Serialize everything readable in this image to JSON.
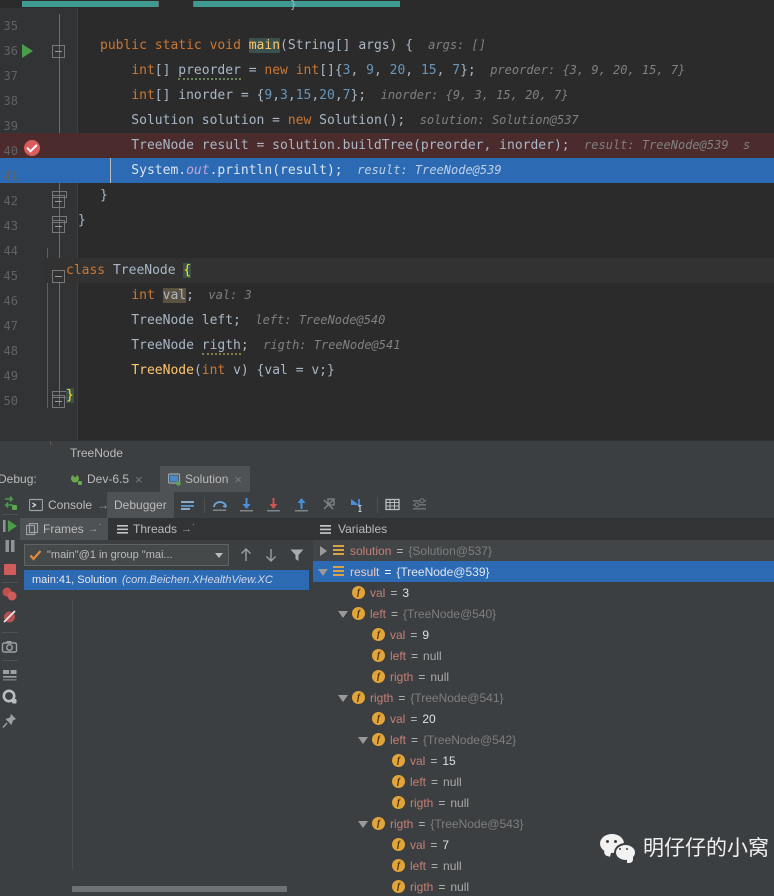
{
  "editor": {
    "top_bar_brace": "}",
    "lines": [
      {
        "no": "35",
        "text": ""
      },
      {
        "no": "36",
        "text": "public static void main(String[] args) {",
        "hint": "args: []"
      },
      {
        "no": "37",
        "text": "int[] preorder = new int[]{3, 9, 20, 15, 7};",
        "hint": "preorder: {3, 9, 20, 15, 7}"
      },
      {
        "no": "38",
        "text": "int[] inorder = {9,3,15,20,7};",
        "hint": "inorder: {9, 3, 15, 20, 7}"
      },
      {
        "no": "39",
        "text": "Solution solution = new Solution();",
        "hint": "solution: Solution@537"
      },
      {
        "no": "40",
        "text": "TreeNode result = solution.buildTree(preorder, inorder);",
        "hint": "result: TreeNode@539  s"
      },
      {
        "no": "41",
        "text": "System.out.println(result);",
        "hint": "result: TreeNode@539"
      },
      {
        "no": "42",
        "text": "}"
      },
      {
        "no": "43",
        "text": "}"
      },
      {
        "no": "44",
        "text": ""
      },
      {
        "no": "45",
        "text": "class TreeNode {"
      },
      {
        "no": "46",
        "text": "int val;",
        "hint": "val: 3"
      },
      {
        "no": "47",
        "text": "TreeNode left;",
        "hint": "left: TreeNode@540"
      },
      {
        "no": "48",
        "text": "TreeNode rigth;",
        "hint": "rigth: TreeNode@541"
      },
      {
        "no": "49",
        "text": "TreeNode(int v) {val = v;}"
      },
      {
        "no": "50",
        "text": "}"
      }
    ],
    "tokens": {
      "kw_public": "public",
      "kw_static": "static",
      "kw_void": "void",
      "fn_main": "main",
      "t_string_args": "(String[] args) {",
      "kw_int": "int",
      "id_preorder": "preorder",
      "kw_new": "new",
      "kw_class": "class",
      "id_treenode": "TreeNode",
      "id_val": "val",
      "id_left": "left",
      "id_rigth": "rigth",
      "id_v": "v",
      "id_solution": "Solution",
      "id_result": "result",
      "id_system": "System",
      "id_out": "out",
      "id_println": "println",
      "id_inorder": "inorder",
      "id_buildtree": "buildTree"
    }
  },
  "breadcrumb": {
    "path": "TreeNode"
  },
  "debug_tabs": {
    "label": "Debug:",
    "tabs": [
      {
        "name": "Dev-6.5",
        "icon": "android-run-icon",
        "close": "×",
        "active": false
      },
      {
        "name": "Solution",
        "icon": "java-app-icon",
        "close": "×",
        "active": true
      }
    ]
  },
  "rail": {
    "buttons": [
      {
        "name": "rerun-icon",
        "title": "Rerun"
      },
      {
        "name": "resume-program-icon",
        "title": "Resume Program"
      },
      {
        "name": "pause-program-icon",
        "title": "Pause Program"
      },
      {
        "name": "stop-icon",
        "title": "Stop"
      },
      {
        "name": "view-breakpoints-icon",
        "title": "View Breakpoints"
      },
      {
        "name": "mute-breakpoints-icon",
        "title": "Mute Breakpoints"
      },
      {
        "name": "get-thread-dump-icon",
        "title": "Get Thread Dump"
      },
      {
        "name": "layout-icon",
        "title": "Restore Layout"
      },
      {
        "name": "settings-icon",
        "title": "Settings"
      },
      {
        "name": "pin-tab-icon",
        "title": "Pin Tab"
      }
    ]
  },
  "debugger_toolbar": {
    "tabs": [
      {
        "label": "Console",
        "icon": "console-icon",
        "overflow": "→˙",
        "selected": false
      },
      {
        "label": "Debugger",
        "icon": "",
        "overflow": "",
        "selected": true
      }
    ],
    "actions": [
      {
        "name": "show-execution-point-icon",
        "title": "Show Execution Point"
      },
      {
        "name": "step-over-icon",
        "title": "Step Over"
      },
      {
        "name": "step-into-icon",
        "title": "Step Into"
      },
      {
        "name": "force-step-into-icon",
        "title": "Force Step Into"
      },
      {
        "name": "step-out-icon",
        "title": "Step Out"
      },
      {
        "name": "drop-frame-icon",
        "title": "Drop Frame"
      },
      {
        "name": "run-to-cursor-icon",
        "title": "Run to Cursor"
      },
      {
        "name": "evaluate-expression-icon",
        "title": "Evaluate Expression"
      },
      {
        "name": "settings-icon",
        "title": "Layout Settings"
      }
    ]
  },
  "frames": {
    "tabs": [
      {
        "label": "Frames",
        "overflow": "→˙",
        "active": true
      },
      {
        "label": "Threads",
        "overflow": "→˙",
        "active": false
      }
    ],
    "thread_selector": {
      "value": "\"main\"@1 in group \"mai...",
      "icon": "check-icon"
    },
    "buttons": [
      {
        "name": "frame-up-icon",
        "glyph": "↑"
      },
      {
        "name": "frame-down-icon",
        "glyph": "↓"
      },
      {
        "name": "filter-frames-icon",
        "glyph": "▼"
      }
    ],
    "rows": [
      {
        "location": "main:41, Solution",
        "package": "(com.Beichen.XHealthView.XC",
        "selected": true
      }
    ]
  },
  "variables": {
    "header": "Variables",
    "tree": [
      {
        "indent": 0,
        "toggle": "collapsed",
        "icon": "object-icon",
        "name": "solution",
        "value": "{Solution@537}",
        "kind": "obj",
        "selected": false,
        "hovered": true
      },
      {
        "indent": 0,
        "toggle": "expanded",
        "icon": "object-icon",
        "name": "result",
        "value": "{TreeNode@539}",
        "kind": "obj",
        "selected": true,
        "hovered": false
      },
      {
        "indent": 1,
        "toggle": "none",
        "icon": "field-icon",
        "name": "val",
        "value": "3",
        "kind": "num",
        "selected": false,
        "hovered": false
      },
      {
        "indent": 1,
        "toggle": "expanded",
        "icon": "field-icon",
        "name": "left",
        "value": "{TreeNode@540}",
        "kind": "obj",
        "selected": false,
        "hovered": false
      },
      {
        "indent": 2,
        "toggle": "none",
        "icon": "field-icon",
        "name": "val",
        "value": "9",
        "kind": "num",
        "selected": false,
        "hovered": false
      },
      {
        "indent": 2,
        "toggle": "none",
        "icon": "field-icon",
        "name": "left",
        "value": "null",
        "kind": "null",
        "selected": false,
        "hovered": false
      },
      {
        "indent": 2,
        "toggle": "none",
        "icon": "field-icon",
        "name": "rigth",
        "value": "null",
        "kind": "null",
        "selected": false,
        "hovered": false
      },
      {
        "indent": 1,
        "toggle": "expanded",
        "icon": "field-icon",
        "name": "rigth",
        "value": "{TreeNode@541}",
        "kind": "obj",
        "selected": false,
        "hovered": false
      },
      {
        "indent": 2,
        "toggle": "none",
        "icon": "field-icon",
        "name": "val",
        "value": "20",
        "kind": "num",
        "selected": false,
        "hovered": false
      },
      {
        "indent": 2,
        "toggle": "expanded",
        "icon": "field-icon",
        "name": "left",
        "value": "{TreeNode@542}",
        "kind": "obj",
        "selected": false,
        "hovered": false
      },
      {
        "indent": 3,
        "toggle": "none",
        "icon": "field-icon",
        "name": "val",
        "value": "15",
        "kind": "num",
        "selected": false,
        "hovered": false
      },
      {
        "indent": 3,
        "toggle": "none",
        "icon": "field-icon",
        "name": "left",
        "value": "null",
        "kind": "null",
        "selected": false,
        "hovered": false
      },
      {
        "indent": 3,
        "toggle": "none",
        "icon": "field-icon",
        "name": "rigth",
        "value": "null",
        "kind": "null",
        "selected": false,
        "hovered": false
      },
      {
        "indent": 2,
        "toggle": "expanded",
        "icon": "field-icon",
        "name": "rigth",
        "value": "{TreeNode@543}",
        "kind": "obj",
        "selected": false,
        "hovered": false
      },
      {
        "indent": 3,
        "toggle": "none",
        "icon": "field-icon",
        "name": "val",
        "value": "7",
        "kind": "num",
        "selected": false,
        "hovered": false
      },
      {
        "indent": 3,
        "toggle": "none",
        "icon": "field-icon",
        "name": "left",
        "value": "null",
        "kind": "null",
        "selected": false,
        "hovered": false
      },
      {
        "indent": 3,
        "toggle": "none",
        "icon": "field-icon",
        "name": "rigth",
        "value": "null",
        "kind": "null",
        "selected": false,
        "hovered": false
      }
    ],
    "field_icon_letter": "f"
  },
  "watermark": {
    "text": "明仔仔的小窝",
    "icon": "wechat-icon"
  },
  "colors": {
    "editor_bg": "#2b2b2b",
    "gutter_bg": "#313335",
    "panel_bg": "#3c3f41",
    "selection_blue": "#2d6ab4",
    "breakpoint_red": "#4b2b2c",
    "keyword": "#cc7832",
    "number": "#6897bb",
    "method": "#ffc66d",
    "field": "#9876aa",
    "hint": "#808080"
  }
}
